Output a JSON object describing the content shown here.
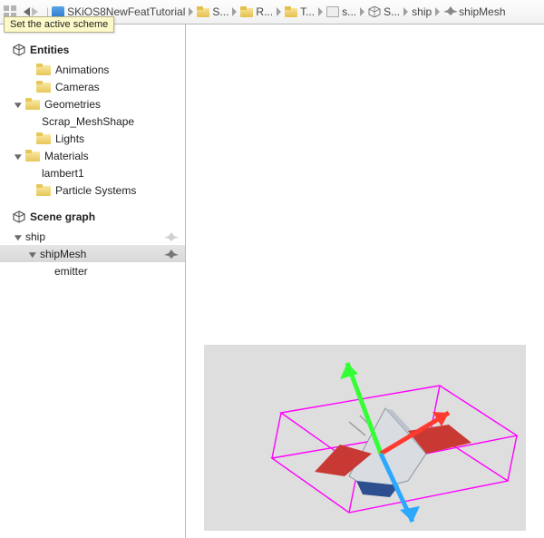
{
  "toolbar": {
    "tooltip": "Set the active scheme"
  },
  "breadcrumb": [
    {
      "icon": "proj",
      "label": "SKiOS8NewFeatTutorial"
    },
    {
      "icon": "folder",
      "label": "S..."
    },
    {
      "icon": "folder",
      "label": "R..."
    },
    {
      "icon": "folder",
      "label": "T..."
    },
    {
      "icon": "file",
      "label": "s..."
    },
    {
      "icon": "cube",
      "label": "S..."
    },
    {
      "icon": "none",
      "label": "ship"
    },
    {
      "icon": "ship",
      "label": "shipMesh"
    }
  ],
  "sections": {
    "entities": {
      "title": "Entities",
      "items": [
        {
          "kind": "folder",
          "label": "Animations",
          "indent": 1
        },
        {
          "kind": "folder",
          "label": "Cameras",
          "indent": 1
        },
        {
          "kind": "folder",
          "label": "Geometries",
          "indent": 1,
          "open": true,
          "children": [
            {
              "kind": "leaf",
              "label": "Scrap_MeshShape",
              "indent": 2
            }
          ]
        },
        {
          "kind": "folder",
          "label": "Lights",
          "indent": 1
        },
        {
          "kind": "folder",
          "label": "Materials",
          "indent": 1,
          "open": true,
          "children": [
            {
              "kind": "leaf",
              "label": "lambert1",
              "indent": 2
            }
          ]
        },
        {
          "kind": "folder",
          "label": "Particle Systems",
          "indent": 1
        }
      ]
    },
    "scenegraph": {
      "title": "Scene graph",
      "items": [
        {
          "kind": "node",
          "label": "ship",
          "indent": 0,
          "open": true,
          "glyph": "weak"
        },
        {
          "kind": "node",
          "label": "shipMesh",
          "indent": 1,
          "open": true,
          "selected": true,
          "glyph": "strong"
        },
        {
          "kind": "leaf",
          "label": "emitter",
          "indent": 2
        }
      ]
    }
  },
  "colors": {
    "folder": "#e6c659",
    "selectionBg": "#dcdcdc",
    "tooltipBg": "#fdf9c8",
    "boundingBox": "#ff00ff",
    "axisX": "#ff3b30",
    "axisY": "#34ff34",
    "axisZ": "#2da8ff",
    "viewportBg": "#dedede"
  }
}
